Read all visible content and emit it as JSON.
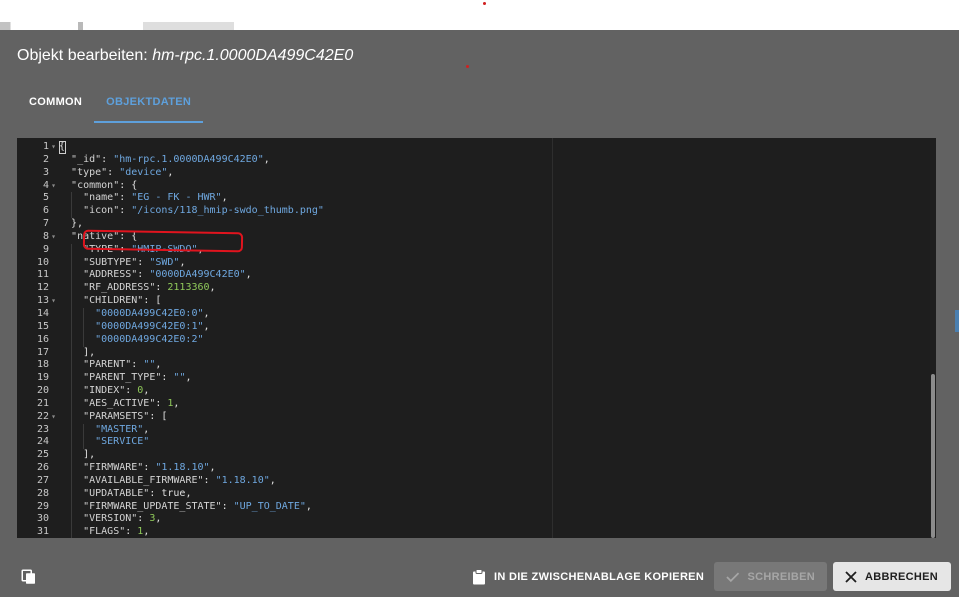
{
  "dialog": {
    "title_prefix": "Objekt bearbeiten:",
    "object_id": "hm-rpc.1.0000DA499C42E0"
  },
  "tabs": [
    {
      "label": "COMMON",
      "active": false
    },
    {
      "label": "OBJEKTDATEN",
      "active": true
    }
  ],
  "editor": {
    "line_numbers": [
      "1",
      "2",
      "3",
      "4",
      "5",
      "6",
      "7",
      "8",
      "9",
      "10",
      "11",
      "12",
      "13",
      "14",
      "15",
      "16",
      "17",
      "18",
      "19",
      "20",
      "21",
      "22",
      "23",
      "24",
      "25",
      "26",
      "27",
      "28",
      "29",
      "30",
      "31"
    ],
    "foldable_lines": [
      1,
      4,
      8,
      13,
      22
    ],
    "lines": [
      "{",
      "  \"_id\": \"hm-rpc.1.0000DA499C42E0\",",
      "  \"type\": \"device\",",
      "  \"common\": {",
      "    \"name\": \"EG - FK - HWR\",",
      "    \"icon\": \"/icons/118_hmip-swdo_thumb.png\"",
      "  },",
      "  \"native\": {",
      "    \"TYPE\": \"HMIP-SWDO\",",
      "    \"SUBTYPE\": \"SWD\",",
      "    \"ADDRESS\": \"0000DA499C42E0\",",
      "    \"RF_ADDRESS\": 2113360,",
      "    \"CHILDREN\": [",
      "      \"0000DA499C42E0:0\",",
      "      \"0000DA499C42E0:1\",",
      "      \"0000DA499C42E0:2\"",
      "    ],",
      "    \"PARENT\": \"\",",
      "    \"PARENT_TYPE\": \"\",",
      "    \"INDEX\": 0,",
      "    \"AES_ACTIVE\": 1,",
      "    \"PARAMSETS\": [",
      "      \"MASTER\",",
      "      \"SERVICE\"",
      "    ],",
      "    \"FIRMWARE\": \"1.18.10\",",
      "    \"AVAILABLE_FIRMWARE\": \"1.18.10\",",
      "    \"UPDATABLE\": true,",
      "    \"FIRMWARE_UPDATE_STATE\": \"UP_TO_DATE\",",
      "    \"VERSION\": 3,",
      "    \"FLAGS\": 1,"
    ]
  },
  "footer": {
    "copy_clipboard_label": "IN DIE ZWISCHENABLAGE KOPIEREN",
    "save_label": "SCHREIBEN",
    "cancel_label": "ABBRECHEN"
  },
  "colors": {
    "dialog_bg": "#626262",
    "editor_bg": "#1e1e1e",
    "accent": "#5ea0dc",
    "string": "#6fa8e0",
    "number": "#8fc85a",
    "annotation": "#e0141e"
  },
  "icons": [
    "copy-icon",
    "clipboard-icon",
    "check-icon",
    "close-icon",
    "fold-arrow-icon"
  ]
}
